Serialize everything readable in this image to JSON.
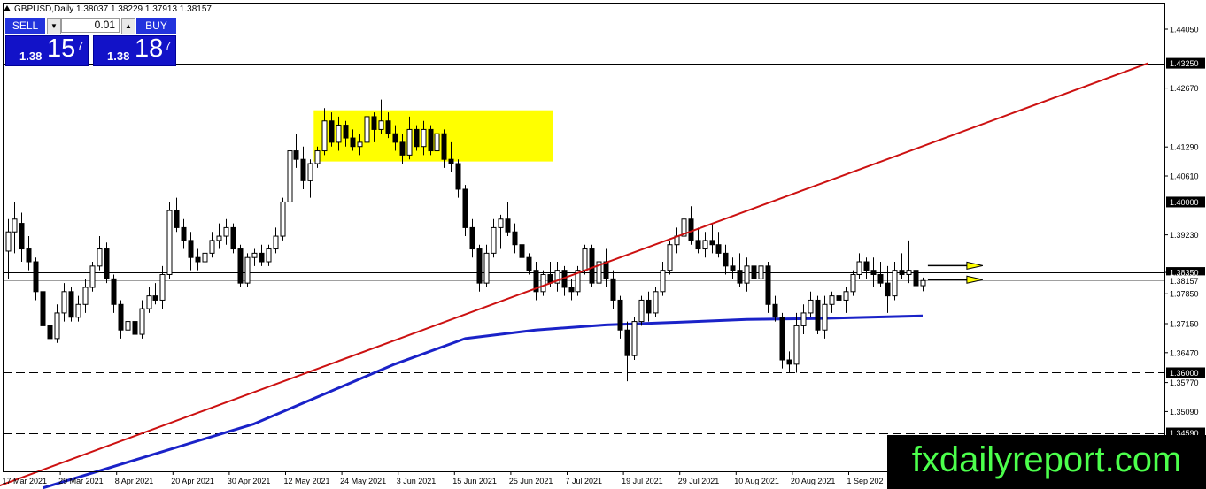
{
  "header": {
    "symbol_info": "GBPUSD,Daily  1.38037 1.38229 1.37913 1.38157",
    "triangle_icon": "triangle-up-icon"
  },
  "trade_panel": {
    "sell_label": "SELL",
    "buy_label": "BUY",
    "lot_value": "0.01",
    "sell_price": {
      "small": "1.38",
      "big": "15",
      "sup": "7"
    },
    "buy_price": {
      "small": "1.38",
      "big": "18",
      "sup": "7"
    }
  },
  "watermark": "fxdailyreport.com",
  "colors": {
    "trendline": "#cc1111",
    "moving_average": "#1a22c8",
    "consolidation_box": "#ffff00",
    "arrow_fill": "#ffff00",
    "bull_candle": "#ffffff",
    "bear_candle": "#000000"
  },
  "chart_data": {
    "type": "candlestick",
    "symbol": "GBPUSD",
    "timeframe": "Daily",
    "ylim": [
      1.334,
      1.452
    ],
    "y_ticks": [
      "1.44050",
      "1.42670",
      "1.41290",
      "1.40610",
      "1.39230",
      "1.38350",
      "1.37850",
      "1.37150",
      "1.36470",
      "1.35770",
      "1.35090"
    ],
    "x_tick_labels": [
      "17 Mar 2021",
      "29 Mar 2021",
      "8 Apr 2021",
      "20 Apr 2021",
      "30 Apr 2021",
      "12 May 2021",
      "24 May 2021",
      "3 Jun 2021",
      "15 Jun 2021",
      "25 Jun 2021",
      "7 Jul 2021",
      "19 Jul 2021",
      "29 Jul 2021",
      "10 Aug 2021",
      "20 Aug 2021",
      "1 Sep 202"
    ],
    "x_tick_index": [
      0,
      8,
      16,
      24,
      32,
      40,
      48,
      56,
      64,
      72,
      80,
      88,
      96,
      104,
      112,
      120
    ],
    "price_lines": [
      {
        "label": "1.43250",
        "value": 1.4325,
        "style": "solid"
      },
      {
        "label": "1.40000",
        "value": 1.4,
        "style": "solid"
      },
      {
        "label": "1.38350",
        "value": 1.3835,
        "style": "solid"
      },
      {
        "label": "1.38157",
        "value": 1.38157,
        "style": "current"
      },
      {
        "label": "1.36000",
        "value": 1.36,
        "style": "dashed"
      },
      {
        "label": "1.34590",
        "value": 1.3459,
        "style": "dashed"
      }
    ],
    "trendline": {
      "from": [
        -2,
        1.333
      ],
      "to": [
        162,
        1.4325
      ]
    },
    "moving_average": [
      [
        5,
        1.333
      ],
      [
        15,
        1.338
      ],
      [
        25,
        1.343
      ],
      [
        35,
        1.348
      ],
      [
        45,
        1.355
      ],
      [
        55,
        1.362
      ],
      [
        65,
        1.368
      ],
      [
        75,
        1.37
      ],
      [
        85,
        1.3712
      ],
      [
        95,
        1.3718
      ],
      [
        105,
        1.3725
      ],
      [
        115,
        1.3727
      ],
      [
        130,
        1.3733
      ]
    ],
    "consolidation_box": {
      "from_index": 44,
      "to_index": 77,
      "top": 1.4215,
      "bottom": 1.4095
    },
    "arrows": [
      {
        "index": 132,
        "value": 1.3851
      },
      {
        "index": 132,
        "value": 1.3818
      }
    ],
    "candles": [
      [
        1.3885,
        1.396,
        1.382,
        1.393
      ],
      [
        1.393,
        1.4,
        1.388,
        1.396
      ],
      [
        1.395,
        1.3975,
        1.386,
        1.389
      ],
      [
        1.389,
        1.392,
        1.384,
        1.386
      ],
      [
        1.386,
        1.387,
        1.377,
        1.379
      ],
      [
        1.379,
        1.38,
        1.369,
        1.371
      ],
      [
        1.371,
        1.372,
        1.366,
        1.368
      ],
      [
        1.368,
        1.376,
        1.367,
        1.374
      ],
      [
        1.374,
        1.381,
        1.372,
        1.379
      ],
      [
        1.379,
        1.38,
        1.372,
        1.373
      ],
      [
        1.373,
        1.378,
        1.372,
        1.376
      ],
      [
        1.376,
        1.382,
        1.374,
        1.38
      ],
      [
        1.38,
        1.386,
        1.379,
        1.385
      ],
      [
        1.385,
        1.392,
        1.384,
        1.389
      ],
      [
        1.389,
        1.3905,
        1.381,
        1.382
      ],
      [
        1.382,
        1.383,
        1.374,
        1.376
      ],
      [
        1.376,
        1.377,
        1.368,
        1.37
      ],
      [
        1.37,
        1.374,
        1.367,
        1.372
      ],
      [
        1.372,
        1.373,
        1.367,
        1.369
      ],
      [
        1.369,
        1.377,
        1.368,
        1.375
      ],
      [
        1.375,
        1.38,
        1.374,
        1.378
      ],
      [
        1.378,
        1.381,
        1.376,
        1.377
      ],
      [
        1.377,
        1.385,
        1.375,
        1.383
      ],
      [
        1.383,
        1.4,
        1.382,
        1.398
      ],
      [
        1.398,
        1.401,
        1.393,
        1.394
      ],
      [
        1.394,
        1.396,
        1.389,
        1.391
      ],
      [
        1.391,
        1.393,
        1.384,
        1.387
      ],
      [
        1.387,
        1.389,
        1.384,
        1.386
      ],
      [
        1.386,
        1.39,
        1.384,
        1.388
      ],
      [
        1.388,
        1.393,
        1.387,
        1.391
      ],
      [
        1.391,
        1.395,
        1.389,
        1.392
      ],
      [
        1.392,
        1.396,
        1.39,
        1.394
      ],
      [
        1.394,
        1.395,
        1.388,
        1.389
      ],
      [
        1.389,
        1.39,
        1.38,
        1.381
      ],
      [
        1.381,
        1.388,
        1.38,
        1.387
      ],
      [
        1.387,
        1.389,
        1.385,
        1.388
      ],
      [
        1.388,
        1.39,
        1.385,
        1.386
      ],
      [
        1.386,
        1.39,
        1.385,
        1.389
      ],
      [
        1.389,
        1.394,
        1.388,
        1.392
      ],
      [
        1.392,
        1.401,
        1.391,
        1.4
      ],
      [
        1.4,
        1.414,
        1.399,
        1.412
      ],
      [
        1.412,
        1.416,
        1.408,
        1.41
      ],
      [
        1.41,
        1.413,
        1.403,
        1.405
      ],
      [
        1.405,
        1.41,
        1.401,
        1.409
      ],
      [
        1.409,
        1.413,
        1.408,
        1.412
      ],
      [
        1.412,
        1.422,
        1.411,
        1.419
      ],
      [
        1.419,
        1.421,
        1.413,
        1.414
      ],
      [
        1.414,
        1.42,
        1.412,
        1.418
      ],
      [
        1.418,
        1.419,
        1.413,
        1.415
      ],
      [
        1.415,
        1.417,
        1.412,
        1.413
      ],
      [
        1.413,
        1.416,
        1.411,
        1.414
      ],
      [
        1.414,
        1.422,
        1.413,
        1.42
      ],
      [
        1.42,
        1.421,
        1.414,
        1.417
      ],
      [
        1.417,
        1.424,
        1.416,
        1.419
      ],
      [
        1.419,
        1.421,
        1.415,
        1.416
      ],
      [
        1.416,
        1.418,
        1.412,
        1.414
      ],
      [
        1.414,
        1.416,
        1.409,
        1.411
      ],
      [
        1.411,
        1.42,
        1.41,
        1.417
      ],
      [
        1.417,
        1.418,
        1.412,
        1.413
      ],
      [
        1.413,
        1.419,
        1.411,
        1.417
      ],
      [
        1.417,
        1.418,
        1.411,
        1.412
      ],
      [
        1.412,
        1.419,
        1.41,
        1.416
      ],
      [
        1.416,
        1.417,
        1.408,
        1.41
      ],
      [
        1.41,
        1.414,
        1.407,
        1.409
      ],
      [
        1.409,
        1.41,
        1.401,
        1.403
      ],
      [
        1.403,
        1.404,
        1.392,
        1.394
      ],
      [
        1.394,
        1.396,
        1.387,
        1.389
      ],
      [
        1.389,
        1.39,
        1.379,
        1.381
      ],
      [
        1.381,
        1.39,
        1.38,
        1.388
      ],
      [
        1.388,
        1.396,
        1.387,
        1.394
      ],
      [
        1.394,
        1.397,
        1.389,
        1.396
      ],
      [
        1.396,
        1.4,
        1.392,
        1.393
      ],
      [
        1.393,
        1.395,
        1.388,
        1.39
      ],
      [
        1.39,
        1.391,
        1.385,
        1.387
      ],
      [
        1.387,
        1.388,
        1.383,
        1.384
      ],
      [
        1.384,
        1.386,
        1.377,
        1.379
      ],
      [
        1.379,
        1.384,
        1.378,
        1.383
      ],
      [
        1.383,
        1.386,
        1.38,
        1.381
      ],
      [
        1.381,
        1.386,
        1.379,
        1.384
      ],
      [
        1.384,
        1.385,
        1.378,
        1.38
      ],
      [
        1.38,
        1.382,
        1.377,
        1.379
      ],
      [
        1.379,
        1.385,
        1.378,
        1.384
      ],
      [
        1.384,
        1.39,
        1.383,
        1.389
      ],
      [
        1.389,
        1.39,
        1.38,
        1.381
      ],
      [
        1.381,
        1.388,
        1.38,
        1.386
      ],
      [
        1.386,
        1.389,
        1.38,
        1.382
      ],
      [
        1.382,
        1.384,
        1.375,
        1.377
      ],
      [
        1.377,
        1.378,
        1.368,
        1.37
      ],
      [
        1.37,
        1.372,
        1.358,
        1.364
      ],
      [
        1.364,
        1.373,
        1.363,
        1.372
      ],
      [
        1.372,
        1.378,
        1.371,
        1.377
      ],
      [
        1.377,
        1.379,
        1.372,
        1.374
      ],
      [
        1.374,
        1.38,
        1.373,
        1.379
      ],
      [
        1.379,
        1.386,
        1.378,
        1.384
      ],
      [
        1.384,
        1.391,
        1.383,
        1.39
      ],
      [
        1.39,
        1.394,
        1.388,
        1.392
      ],
      [
        1.392,
        1.398,
        1.391,
        1.396
      ],
      [
        1.396,
        1.399,
        1.39,
        1.391
      ],
      [
        1.391,
        1.394,
        1.388,
        1.389
      ],
      [
        1.389,
        1.393,
        1.387,
        1.391
      ],
      [
        1.391,
        1.395,
        1.388,
        1.39
      ],
      [
        1.39,
        1.393,
        1.387,
        1.388
      ],
      [
        1.388,
        1.39,
        1.383,
        1.385
      ],
      [
        1.385,
        1.387,
        1.382,
        1.384
      ],
      [
        1.384,
        1.388,
        1.38,
        1.381
      ],
      [
        1.381,
        1.387,
        1.379,
        1.385
      ],
      [
        1.385,
        1.387,
        1.38,
        1.382
      ],
      [
        1.382,
        1.387,
        1.381,
        1.385
      ],
      [
        1.385,
        1.386,
        1.374,
        1.376
      ],
      [
        1.376,
        1.378,
        1.372,
        1.373
      ],
      [
        1.373,
        1.374,
        1.361,
        1.363
      ],
      [
        1.363,
        1.365,
        1.36,
        1.362
      ],
      [
        1.362,
        1.374,
        1.36,
        1.371
      ],
      [
        1.371,
        1.376,
        1.369,
        1.374
      ],
      [
        1.374,
        1.379,
        1.373,
        1.377
      ],
      [
        1.377,
        1.378,
        1.369,
        1.37
      ],
      [
        1.37,
        1.378,
        1.368,
        1.376
      ],
      [
        1.376,
        1.379,
        1.374,
        1.378
      ],
      [
        1.378,
        1.381,
        1.376,
        1.377
      ],
      [
        1.377,
        1.38,
        1.374,
        1.379
      ],
      [
        1.379,
        1.384,
        1.378,
        1.383
      ],
      [
        1.383,
        1.388,
        1.382,
        1.386
      ],
      [
        1.386,
        1.387,
        1.382,
        1.384
      ],
      [
        1.384,
        1.387,
        1.38,
        1.383
      ],
      [
        1.383,
        1.386,
        1.38,
        1.381
      ],
      [
        1.381,
        1.385,
        1.374,
        1.378
      ],
      [
        1.378,
        1.386,
        1.377,
        1.384
      ],
      [
        1.384,
        1.388,
        1.382,
        1.383
      ],
      [
        1.383,
        1.391,
        1.381,
        1.384
      ],
      [
        1.384,
        1.385,
        1.379,
        1.3804
      ],
      [
        1.3804,
        1.3823,
        1.3791,
        1.3816
      ]
    ]
  }
}
